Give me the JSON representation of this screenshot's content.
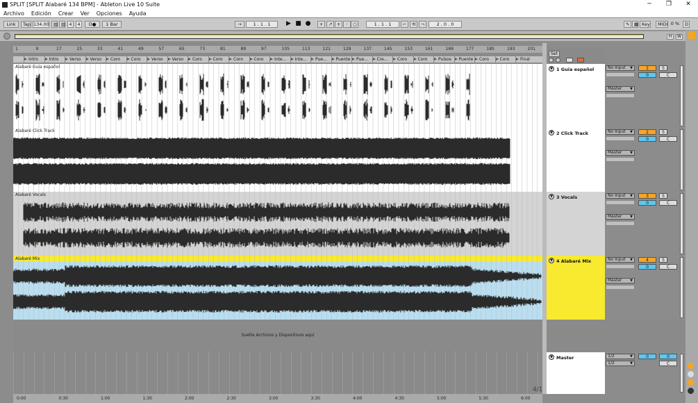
{
  "window": {
    "title": "SPLIT  [SPLIT Alabaré 134 BPM] - Ableton Live 10 Suite",
    "controls": [
      "─",
      "❐",
      "✕"
    ]
  },
  "menu": [
    "Archivo",
    "Edición",
    "Crear",
    "Ver",
    "Opciones",
    "Ayuda"
  ],
  "control_bar": {
    "link": "Link",
    "tap": "Tap",
    "tempo": "134.00",
    "signature_num": "4",
    "signature_den": "4",
    "metro_label": "O●",
    "quantize": "1 Bar",
    "arrangement_pos": "1 .  1 .  1",
    "loop_start": "1 .  1 .  1",
    "loop_length": "2 .  0 .  0",
    "key": "Key",
    "midi": "MIDI",
    "cpu": "0 %",
    "d": "D"
  },
  "overview": {
    "h": "H",
    "w": "W"
  },
  "ruler_bars": [
    "1",
    "9",
    "17",
    "25",
    "33",
    "41",
    "49",
    "57",
    "65",
    "73",
    "81",
    "89",
    "97",
    "105",
    "113",
    "121",
    "129",
    "137",
    "145",
    "153",
    "161",
    "169",
    "177",
    "185",
    "193",
    "201"
  ],
  "locators": [
    "Intro",
    "Intro",
    "Verso",
    "Verso",
    "Coro",
    "Coro",
    "Verso",
    "Verso",
    "Coro",
    "Coro",
    "Coro",
    "Coro",
    "Inte...",
    "Inte...",
    "Pue...",
    "Puente",
    "Pue...",
    "Cre...",
    "Coro",
    "Coro",
    "Pulsos",
    "Puente",
    "Coro",
    "Coro",
    "Final"
  ],
  "clips": {
    "guia": "Alabaré Guia español",
    "click": "Alabaré Click Track",
    "vocals": "Alabaré Vocals",
    "mix": "Alabaré Mix"
  },
  "drop_hint": "Suelte Archivos y Dispositivos aquí",
  "time_labels": [
    "0:00",
    "0:30",
    "1:00",
    "1:30",
    "2:00",
    "2:30",
    "3:00",
    "3:30",
    "4:00",
    "4:30",
    "5:00",
    "5:30",
    "6:00"
  ],
  "zoom_indicator": "4/1",
  "set_label": "Set",
  "tracks": [
    {
      "name": "1 Guia español",
      "input": "No Input",
      "output": "Master",
      "number": "1",
      "volume": "0",
      "solo": "S",
      "cue": "C"
    },
    {
      "name": "2 Click Track",
      "input": "No Input",
      "output": "Master",
      "number": "2",
      "volume": "0",
      "solo": "S",
      "cue": "C"
    },
    {
      "name": "3 Vocals",
      "input": "No Input",
      "output": "Master",
      "number": "3",
      "volume": "0",
      "solo": "S",
      "cue": "C"
    },
    {
      "name": "4 Alabaré Mix",
      "input": "No Input",
      "output": "Master",
      "number": "4",
      "volume": "0",
      "solo": "S",
      "cue": "C"
    }
  ],
  "master": {
    "name": "Master",
    "out1": "1/2",
    "out2": "1/2",
    "volume": "0",
    "pan": "0",
    "cue": "C"
  },
  "colors": {
    "track_yellow": "#f7ea2f",
    "track_blue": "#5cc8f0",
    "track_orange": "#f5a623",
    "mix_clip_bg": "#b9def0",
    "waveform": "#2b2b2b"
  }
}
